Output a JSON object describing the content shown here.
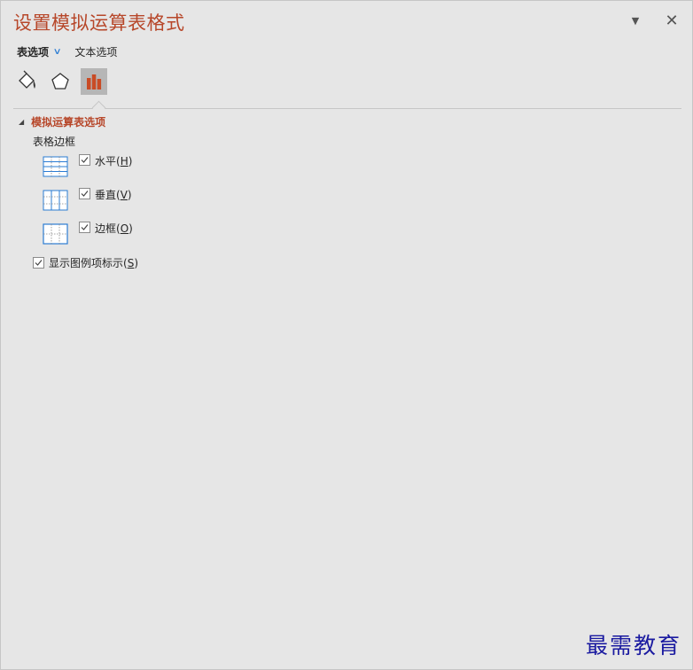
{
  "pane": {
    "title": "设置模拟运算表格式",
    "dropdown_icon": "triangle-down-icon",
    "close_icon": "close-icon"
  },
  "tabs": {
    "active": "表选项",
    "other": "文本选项"
  },
  "icon_tabs": [
    {
      "name": "fill-line-icon",
      "active": false
    },
    {
      "name": "effects-pentagon-icon",
      "active": false
    },
    {
      "name": "chart-options-icon",
      "active": true
    }
  ],
  "section": {
    "title": "模拟运算表选项",
    "group_label": "表格边框",
    "options": [
      {
        "label": "水平",
        "key": "H",
        "checked": true
      },
      {
        "label": "垂直",
        "key": "V",
        "checked": true
      },
      {
        "label": "边框",
        "key": "O",
        "checked": true
      }
    ],
    "legend": {
      "label": "显示图例项标示",
      "key": "S",
      "checked": true
    }
  },
  "colors": {
    "title": "#b7472a",
    "accent_blue": "#2b7cd3",
    "chart_icon": "#c94b25"
  },
  "watermark": "最需教育"
}
